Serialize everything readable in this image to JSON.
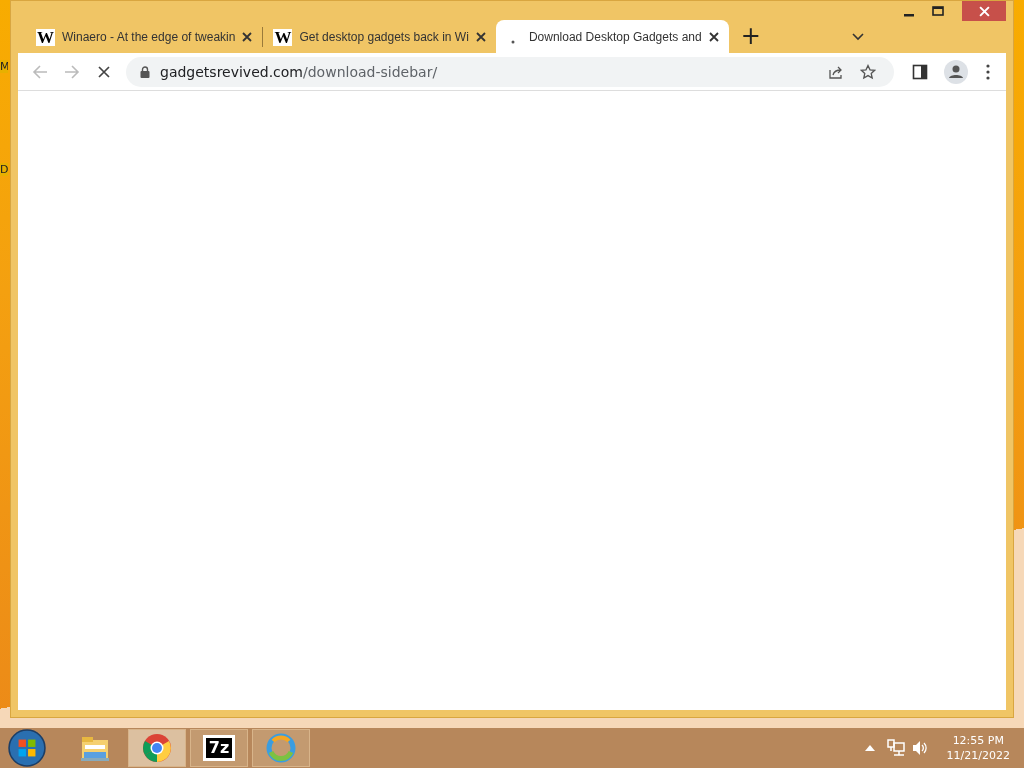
{
  "desktop": {
    "icon_labels": [
      "M",
      "D"
    ]
  },
  "window": {
    "tabs": [
      {
        "title": "Winaero - At the edge of tweakin",
        "favicon": "W",
        "selected": false,
        "loading": false
      },
      {
        "title": "Get desktop gadgets back in Wi",
        "favicon": "W",
        "selected": false,
        "loading": false
      },
      {
        "title": "Download Desktop Gadgets and",
        "selected": true,
        "loading": true
      }
    ],
    "new_tab": "+",
    "address": {
      "domain": "gadgetsrevived.com",
      "path": "/download-sidebar/"
    },
    "loading": true
  },
  "taskbar": {
    "apps": [
      {
        "kind": "explorer",
        "running": false,
        "selected": false
      },
      {
        "kind": "chrome",
        "running": true,
        "selected": true
      },
      {
        "kind": "sevenzip",
        "label": "7z",
        "running": true,
        "selected": false
      },
      {
        "kind": "edge",
        "running": true,
        "selected": false
      }
    ],
    "time": "12:55 PM",
    "date": "11/21/2022"
  }
}
